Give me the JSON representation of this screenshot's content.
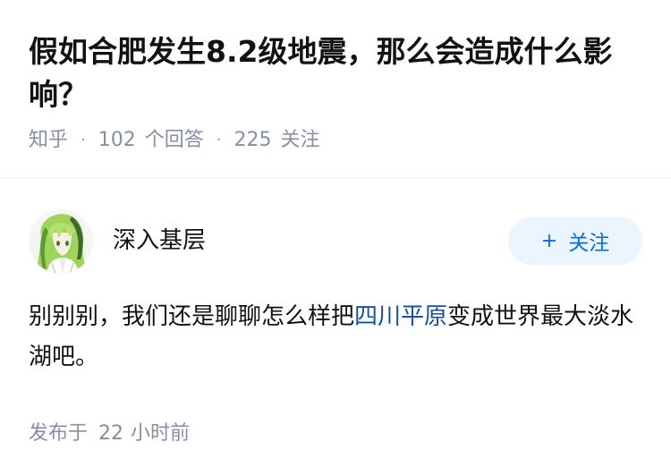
{
  "question": {
    "title": "假如合肥发生8.2级地震，那么会造成什么影响？",
    "source": "知乎",
    "answer_count": "102",
    "answer_label": "个回答",
    "follower_count": "225",
    "follower_label": "关注",
    "separator": "·"
  },
  "answer": {
    "author_name": "深入基层",
    "follow_label": "关注",
    "follow_icon": "plus-icon",
    "text_before_link": "别别别，我们还是聊聊怎么样把",
    "link_text": "四川平原",
    "text_after_link": "变成世界最大淡水湖吧。",
    "link_color": "#175199",
    "published_label": "发布于",
    "published_num": "22",
    "published_unit": "小时前"
  },
  "colors": {
    "accent": "#056de8",
    "button_bg": "#ebf5ff",
    "meta": "#8590a6",
    "text": "#121212"
  }
}
